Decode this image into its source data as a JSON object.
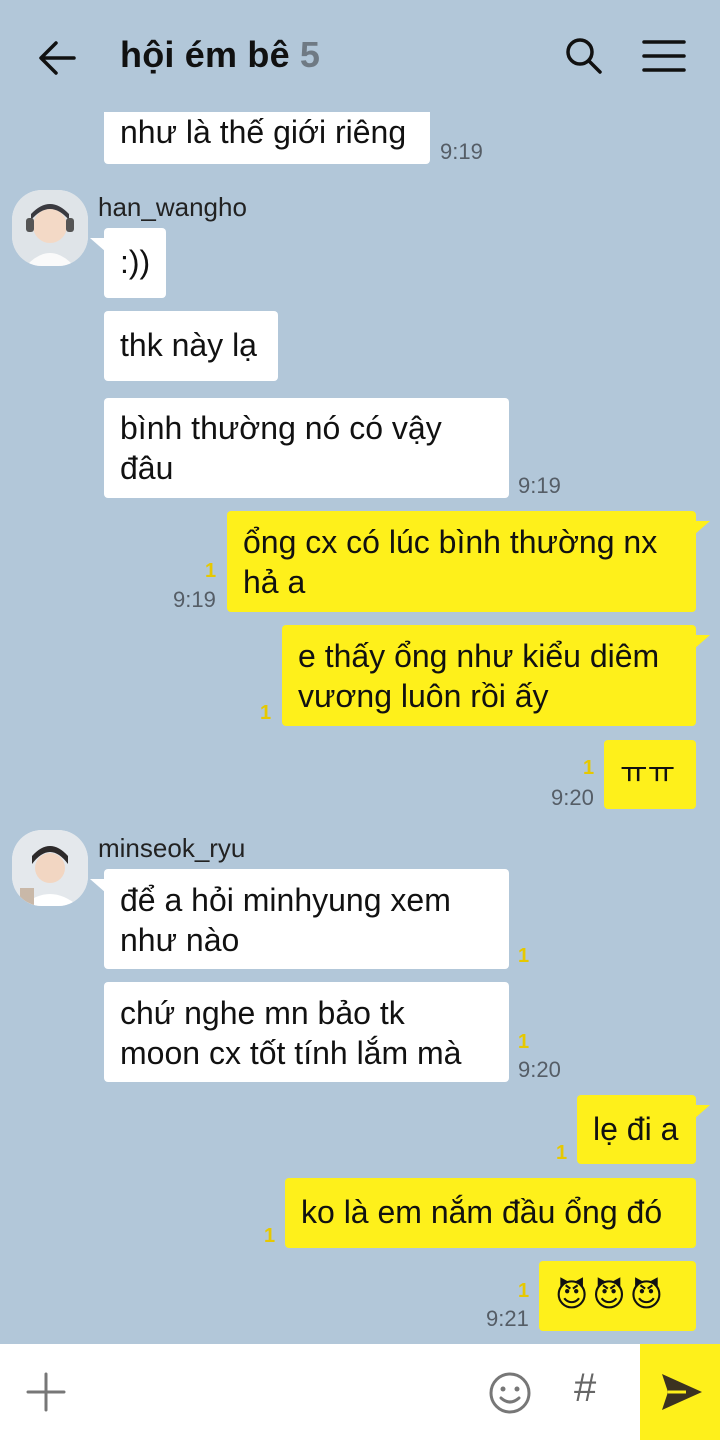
{
  "header": {
    "title": "hội ém bê",
    "member_count": "5"
  },
  "messages": [
    {
      "text": "như là thế giới riêng",
      "time": "9:19"
    },
    {
      "sender": "han_wangho"
    },
    {
      "text": ":))"
    },
    {
      "text": "thk này lạ"
    },
    {
      "text": "bình thường nó có vậy\nđâu",
      "time": "9:19"
    },
    {
      "text": "ổng cx có lúc bình thường nx\nhả a",
      "unread": "1",
      "time": "9:19"
    },
    {
      "text": "e thấy ổng như kiểu diêm\nvương luôn rồi ấy",
      "unread": "1"
    },
    {
      "text": "ㅠㅠ",
      "unread": "1",
      "time": "9:20"
    },
    {
      "sender": "minseok_ryu"
    },
    {
      "text": "để a hỏi minhyung xem\nnhư nào",
      "unread": "1"
    },
    {
      "text": "chứ nghe mn bảo tk\nmoon cx tốt tính lắm mà",
      "unread": "1",
      "time": "9:20"
    },
    {
      "text": "lẹ đi a",
      "unread": "1"
    },
    {
      "text": "ko là em nắm đầu ổng đó",
      "unread": "1"
    },
    {
      "emojis": [
        "😈",
        "😈",
        "😈"
      ],
      "unread": "1",
      "time": "9:21"
    }
  ],
  "input": {
    "placeholder": "",
    "hash_label": "#"
  },
  "colors": {
    "background": "#b2c7d9",
    "incoming_bubble": "#ffffff",
    "outgoing_bubble": "#fef01b",
    "unread": "#e6c800"
  }
}
